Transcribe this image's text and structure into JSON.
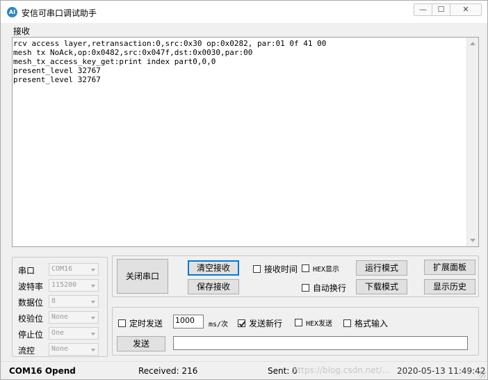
{
  "window": {
    "title": "安信可串口调试助手",
    "icon_text": "AI",
    "controls": {
      "minimize": "—",
      "maximize": "☐",
      "close": "✕"
    }
  },
  "receive": {
    "group_label": "接收",
    "lines": [
      "rcv access layer,retransaction:0,src:0x30 op:0x0282, par:01 0f 41 00",
      "mesh tx NoAck,op:0x0482,src:0x047f,dst:0x0030,par:00",
      "mesh_tx_access_key_get:print index part0,0,0",
      "present_level 32767",
      "present_level 32767"
    ]
  },
  "serial": {
    "rows": [
      {
        "label": "串口",
        "value": "COM16"
      },
      {
        "label": "波特率",
        "value": "115200"
      },
      {
        "label": "数据位",
        "value": "8"
      },
      {
        "label": "校验位",
        "value": "None"
      },
      {
        "label": "停止位",
        "value": "One"
      },
      {
        "label": "流控",
        "value": "None"
      }
    ]
  },
  "controls": {
    "close_port": "关闭串口",
    "clear_receive": "清空接收",
    "save_receive": "保存接收",
    "recv_time": "接收时间",
    "hex_display": "HEX显示",
    "auto_wrap": "自动换行",
    "run_mode": "运行模式",
    "download_mode": "下载模式",
    "expand_panel": "扩展面板",
    "show_history": "显示历史"
  },
  "send": {
    "timed_send": "定时发送",
    "interval_value": "1000",
    "interval_unit": "ms/次",
    "send_newline": "发送新行",
    "send_newline_checked": true,
    "hex_send": "HEX发送",
    "format_input": "格式输入",
    "send_button": "发送",
    "send_text": ""
  },
  "status": {
    "port_state": "COM16 Opend",
    "received": "Received: 216",
    "sent": "Sent: 0",
    "datetime": "2020-05-13 11:49:42",
    "watermark": "https://blog.csdn.net/..."
  }
}
